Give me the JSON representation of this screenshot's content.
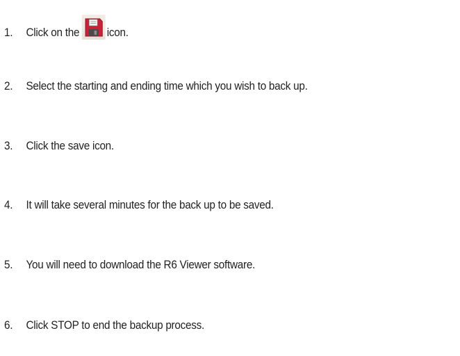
{
  "steps": [
    {
      "number": "1.",
      "text_before": "Click on the",
      "icon": "floppy-disk-save-icon",
      "text_after": "icon."
    },
    {
      "number": "2.",
      "text": "Select the starting and ending time which you wish to back up."
    },
    {
      "number": "3.",
      "text": "Click the save icon."
    },
    {
      "number": "4.",
      "text": "It will take several minutes for the back up to be saved."
    },
    {
      "number": "5.",
      "text": "You will need to download the R6 Viewer software."
    },
    {
      "number": "6.",
      "text": "Click STOP to end the backup process."
    }
  ],
  "colors": {
    "text": "#222222",
    "icon_red": "#c8213a",
    "icon_dark": "#4a4a4a"
  }
}
